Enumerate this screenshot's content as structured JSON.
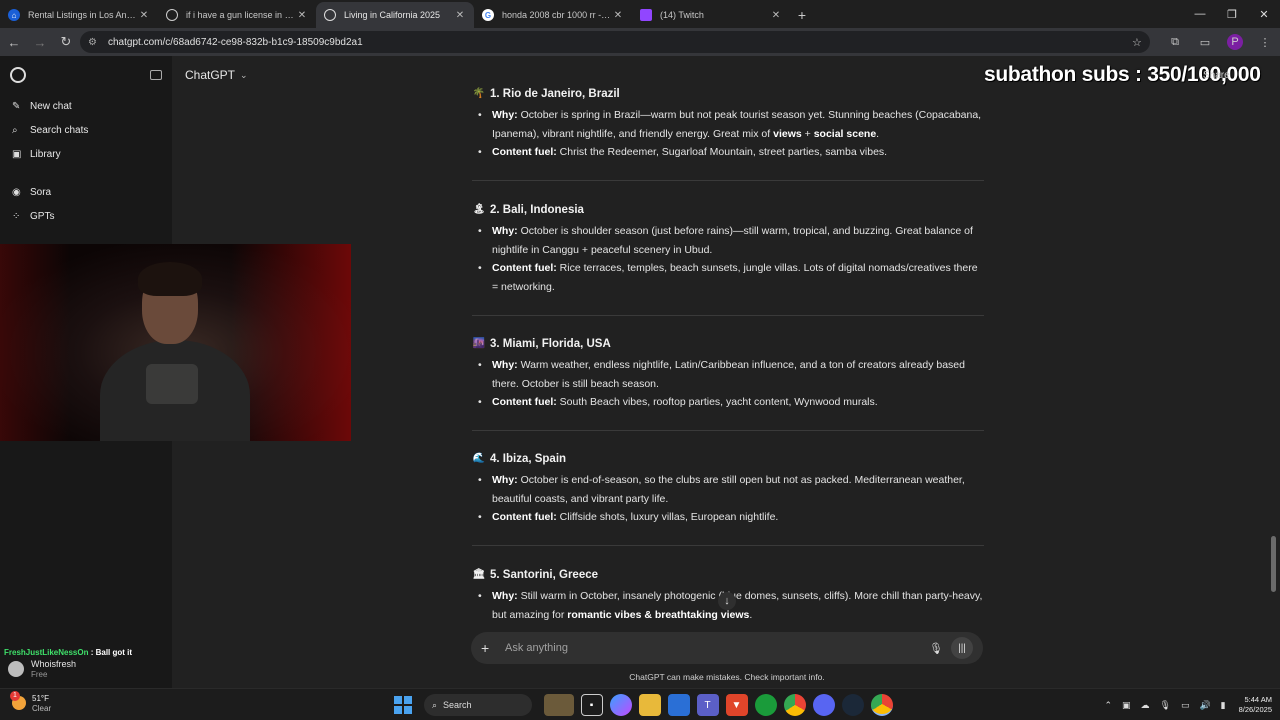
{
  "browser": {
    "tabs": [
      {
        "title": "Rental Listings in Los Angeles C",
        "active": false
      },
      {
        "title": "if i have a gun license in virgini",
        "active": false
      },
      {
        "title": "Living in California 2025",
        "active": true
      },
      {
        "title": "honda 2008 cbr 1000 rr - Goog",
        "active": false
      },
      {
        "title": "(14) Twitch",
        "active": false
      }
    ],
    "url": "chatgpt.com/c/68ad6742-ce98-832b-b1c9-18509c9bd2a1",
    "profile_initial": "P"
  },
  "sidebar": {
    "items": [
      {
        "label": "New chat",
        "icon": "pencil-icon"
      },
      {
        "label": "Search chats",
        "icon": "search-icon"
      },
      {
        "label": "Library",
        "icon": "library-icon"
      },
      {
        "label": "Sora",
        "icon": "sora-icon"
      },
      {
        "label": "GPTs",
        "icon": "grid-icon"
      }
    ]
  },
  "header": {
    "model": "ChatGPT",
    "share": "Share"
  },
  "overlay": {
    "subs": "subathon subs : 350/100,000",
    "chat_user": "FreshJustLikeNessOn",
    "chat_msg": ": Ball got it"
  },
  "user": {
    "name": "Whoisfresh",
    "plan": "Free"
  },
  "sections": [
    {
      "title": "1. Rio de Janeiro, Brazil",
      "emoji": "🌴",
      "why_label": "Why:",
      "why": "October is spring in Brazil—warm but not peak tourist season yet. Stunning beaches (Copacabana, Ipanema), vibrant nightlife, and friendly energy. Great mix of ",
      "why_b1": "views",
      "why_mid": " + ",
      "why_b2": "social scene",
      "why_end": ".",
      "fuel_label": "Content fuel:",
      "fuel": "Christ the Redeemer, Sugarloaf Mountain, street parties, samba vibes."
    },
    {
      "title": "2. Bali, Indonesia",
      "emoji": "🏝",
      "why_label": "Why:",
      "why": "October is shoulder season (just before rains)—still warm, tropical, and buzzing. Great balance of nightlife in Canggu + peaceful scenery in Ubud.",
      "fuel_label": "Content fuel:",
      "fuel": "Rice terraces, temples, beach sunsets, jungle villas. Lots of digital nomads/creatives there = networking."
    },
    {
      "title": "3. Miami, Florida, USA",
      "emoji": "🌆",
      "why_label": "Why:",
      "why": "Warm weather, endless nightlife, Latin/Caribbean influence, and a ton of creators already based there. October is still beach season.",
      "fuel_label": "Content fuel:",
      "fuel": "South Beach vibes, rooftop parties, yacht content, Wynwood murals."
    },
    {
      "title": "4. Ibiza, Spain",
      "emoji": "🌊",
      "why_label": "Why:",
      "why": "October is end-of-season, so the clubs are still open but not as packed. Mediterranean weather, beautiful coasts, and vibrant party life.",
      "fuel_label": "Content fuel:",
      "fuel": "Cliffside shots, luxury villas, European nightlife."
    },
    {
      "title": "5. Santorini, Greece",
      "emoji": "🏛",
      "why_label": "Why:",
      "why": "Still warm in October, insanely photogenic (blue domes, sunsets, cliffs). More chill than party-heavy, but amazing for ",
      "why_b1": "romantic vibes & breathtaking views",
      "why_end": "."
    }
  ],
  "composer": {
    "placeholder": "Ask anything",
    "disclaimer": "ChatGPT can make mistakes. Check important info."
  },
  "taskbar": {
    "temp": "51°F",
    "condition": "Clear",
    "badge": "1",
    "search": "Search",
    "time": "5:44 AM",
    "date": "8/26/2025"
  }
}
